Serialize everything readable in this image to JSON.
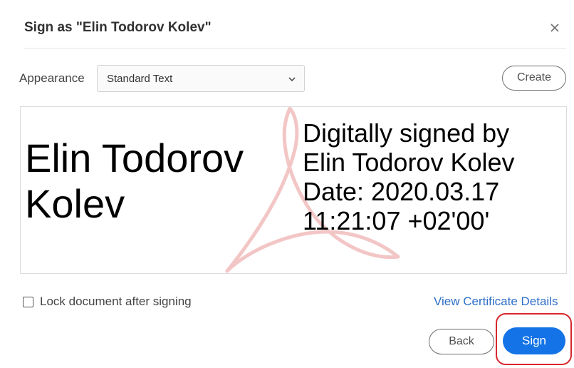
{
  "dialog": {
    "title": "Sign as \"Elin Todorov Kolev\"",
    "close_icon": "close-icon"
  },
  "appearance": {
    "label": "Appearance",
    "selected": "Standard Text",
    "dropdown_icon": "chevron-down-icon",
    "create_label": "Create"
  },
  "preview": {
    "name_text": "Elin Todorov\nKolev",
    "details_text": "Digitally signed by\nElin Todorov Kolev\nDate: 2020.03.17\n11:21:07 +02'00'",
    "watermark_icon": "adobe-acrobat-logo"
  },
  "lock": {
    "label": "Lock document after signing",
    "checked": false
  },
  "links": {
    "view_certificate": "View Certificate Details"
  },
  "footer": {
    "back_label": "Back",
    "sign_label": "Sign"
  },
  "colors": {
    "primary": "#1473e6",
    "link": "#2e6fc7",
    "highlight": "#d9252c",
    "watermark": "#f3c6c6"
  }
}
